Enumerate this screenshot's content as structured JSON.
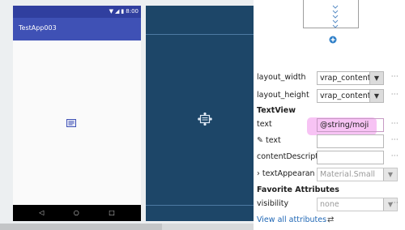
{
  "app": {
    "title": "TestApp003",
    "status_time": "8:00"
  },
  "icons": {
    "wifi": "wifi-icon",
    "signal": "signal-icon",
    "battery": "battery-icon",
    "back": "nav-back-icon",
    "home": "nav-home-icon",
    "recents": "nav-recents-icon",
    "pencil": "pencil-icon",
    "expand": "expand-arrow-icon",
    "swap": "swap-icon"
  },
  "glyphs": {
    "back": "◁",
    "home": "○",
    "recents": "□",
    "more": "···",
    "dropdown": "▼",
    "pencil": "✎",
    "expand": "›",
    "swap": "⇄"
  },
  "attributes": {
    "layout_width": {
      "label": "layout_width",
      "value": "vrap_content"
    },
    "layout_height": {
      "label": "layout_height",
      "value": "vrap_content"
    },
    "section_textview": "TextView",
    "text": {
      "label": "text",
      "value": "@string/moji"
    },
    "tools_text": {
      "label": "text",
      "value": ""
    },
    "content_description": {
      "label": "contentDescript",
      "value": ""
    },
    "text_appearance": {
      "label": "textAppearan",
      "value": "Material.Small"
    },
    "section_favorite": "Favorite Attributes",
    "visibility": {
      "label": "visibility",
      "value": "none"
    },
    "view_all": "View all attributes"
  },
  "colors": {
    "blueprint": "#1d4668",
    "status_bar": "#303f9f",
    "app_bar": "#3f51b5",
    "highlight": "#f6b8f2",
    "link": "#1f67b5"
  }
}
